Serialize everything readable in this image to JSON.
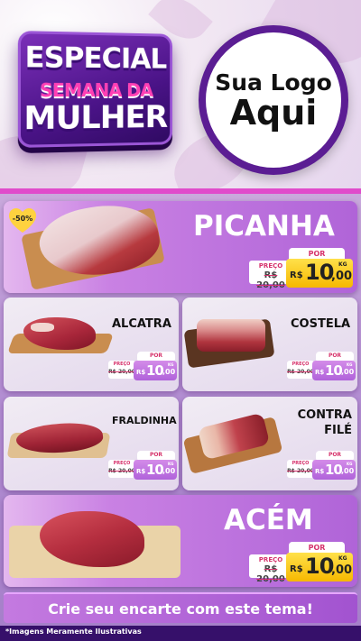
{
  "header": {
    "badge_line1": "ESPECIAL",
    "badge_line2": "SEMANA DA",
    "badge_line3": "MULHER",
    "logo_line1": "Sua Logo",
    "logo_line2": "Aqui"
  },
  "discount_badge": "-50%",
  "products": {
    "picanha": {
      "name": "PICANHA",
      "old_label": "PREÇO",
      "old_price": "R$ 20,00",
      "new_label": "POR",
      "currency": "R$",
      "price_int": "10",
      "price_dec": ",00",
      "unit": "KG"
    },
    "alcatra": {
      "name": "ALCATRA",
      "old_label": "PREÇO",
      "old_price": "R$ 20,00",
      "new_label": "POR",
      "currency": "R$",
      "price_int": "10",
      "price_dec": ",00",
      "unit": "KG"
    },
    "costela": {
      "name": "COSTELA",
      "old_label": "PREÇO",
      "old_price": "R$ 20,00",
      "new_label": "POR",
      "currency": "R$",
      "price_int": "10",
      "price_dec": ",00",
      "unit": "KG"
    },
    "fraldinha": {
      "name": "FRALDINHA",
      "old_label": "PREÇO",
      "old_price": "R$ 20,00",
      "new_label": "POR",
      "currency": "R$",
      "price_int": "10",
      "price_dec": ",00",
      "unit": "KG"
    },
    "contra_file": {
      "name_line1": "CONTRA",
      "name_line2": "FILÉ",
      "old_label": "PREÇO",
      "old_price": "R$ 20,00",
      "new_label": "POR",
      "currency": "R$",
      "price_int": "10",
      "price_dec": ",00",
      "unit": "KG"
    },
    "acem": {
      "name": "ACÉM",
      "old_label": "PREÇO",
      "old_price": "R$ 20,00",
      "new_label": "POR",
      "currency": "R$",
      "price_int": "10",
      "price_dec": ",00",
      "unit": "KG"
    }
  },
  "cta": "Crie seu encarte com este tema!",
  "footer_note": "*Imagens Meramente Ilustrativas",
  "colors": {
    "purple_dark": "#36106a",
    "purple": "#a65fd2",
    "pink_accent": "#e04bcb",
    "price_yellow": "#f6b800"
  }
}
